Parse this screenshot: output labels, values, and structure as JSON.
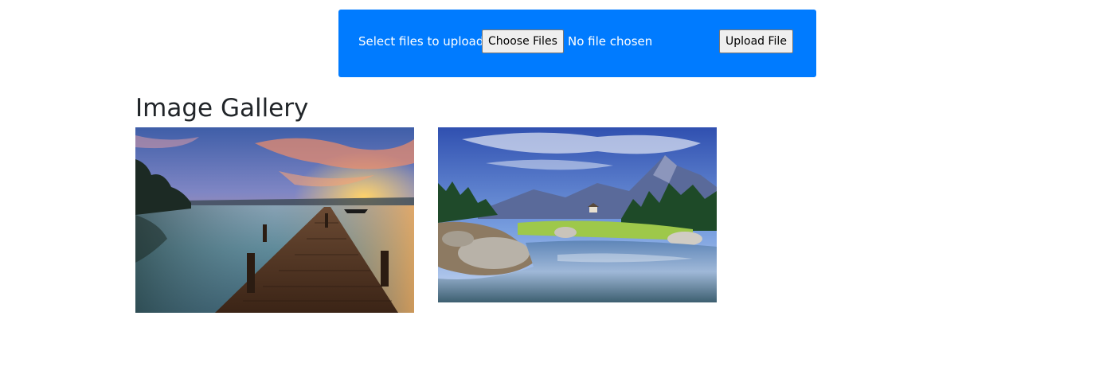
{
  "upload": {
    "label": "Select files to upload:",
    "choose_button": "Choose Files",
    "file_status": "No file chosen",
    "upload_button": "Upload File",
    "panel_color": "#007bff"
  },
  "gallery": {
    "title": "Image Gallery",
    "images": [
      {
        "name": "pier-sunset-image"
      },
      {
        "name": "mountain-lake-image"
      }
    ]
  }
}
